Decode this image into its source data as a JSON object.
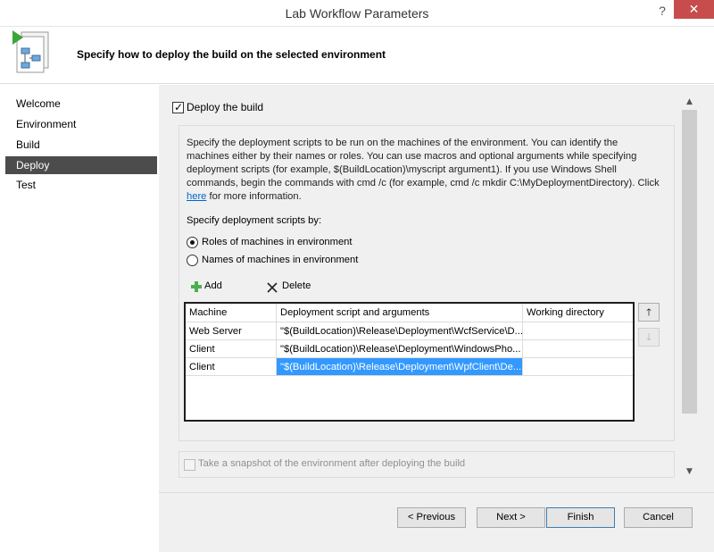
{
  "window": {
    "title": "Lab Workflow Parameters",
    "help_glyph": "?",
    "close_glyph": "✕"
  },
  "header": {
    "text": "Specify how to deploy the build on the selected environment",
    "icon": "workflow-document-icon"
  },
  "sidebar": {
    "items": [
      {
        "label": "Welcome",
        "active": false
      },
      {
        "label": "Environment",
        "active": false
      },
      {
        "label": "Build",
        "active": false
      },
      {
        "label": "Deploy",
        "active": true
      },
      {
        "label": "Test",
        "active": false
      }
    ]
  },
  "deploy": {
    "checkbox_label": "Deploy the build",
    "checked": true,
    "description_before_link": "Specify the deployment scripts to be run on the machines of the environment. You can identify the machines either by their names or roles. You can use macros and optional arguments while specifying deployment scripts (for example, $(BuildLocation)\\myscript argument1). If you use Windows Shell commands, begin the commands with cmd /c (for example, cmd /c mkdir C:\\MyDeploymentDirectory). Click ",
    "description_link": "here",
    "description_after_link": " for more information.",
    "specify_by_label": "Specify deployment scripts by:",
    "radio_roles": "Roles of machines in environment",
    "radio_names": "Names of machines in environment",
    "selected_radio": "roles",
    "add_label": "Add",
    "delete_label": "Delete",
    "table": {
      "columns": [
        "Machine",
        "Deployment script and arguments",
        "Working directory"
      ],
      "rows": [
        {
          "machine": "Web Server",
          "script": "\"$(BuildLocation)\\Release\\Deployment\\WcfService\\D...",
          "dir": ""
        },
        {
          "machine": "Client",
          "script": "\"$(BuildLocation)\\Release\\Deployment\\WindowsPho...",
          "dir": ""
        },
        {
          "machine": "Client",
          "script": "\"$(BuildLocation)\\Release\\Deployment\\WpfClient\\De...",
          "dir": "",
          "selected": true
        }
      ]
    },
    "move_up_glyph": "🡑",
    "move_down_glyph": "🡓",
    "snapshot_label": "Take a snapshot of the environment after deploying the build"
  },
  "footer": {
    "previous": "< Previous",
    "next": "Next >",
    "finish": "Finish",
    "cancel": "Cancel"
  },
  "colors": {
    "selection": "#3399ff",
    "active_nav": "#4c4c4c",
    "close_button": "#c74d4d",
    "add_icon": "#4caf50",
    "link": "#0066cc"
  }
}
